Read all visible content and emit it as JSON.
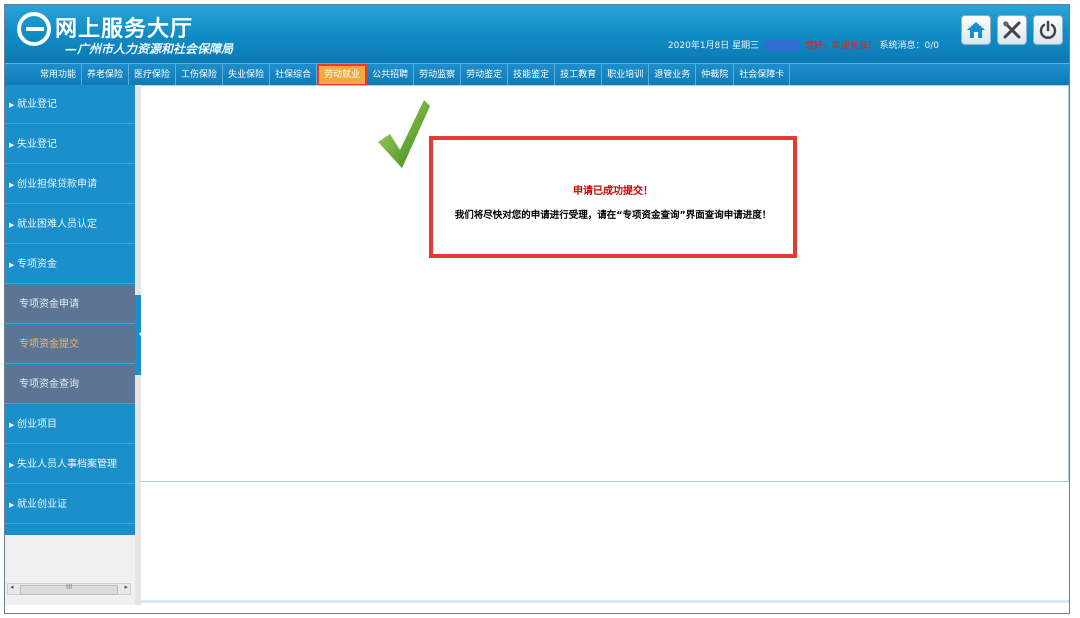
{
  "header": {
    "logo_title": "网上服务大厅",
    "logo_subtitle": "—广州市人力资源和社会保障局",
    "date": "2020年1月8日",
    "weekday": "星期三",
    "welcome": "您好，欢迎光临！",
    "messages_label": "系统消息：0/0",
    "buttons": [
      "home-icon",
      "tools-icon",
      "power-icon"
    ]
  },
  "nav": {
    "items": [
      "常用功能",
      "养老保险",
      "医疗保险",
      "工伤保险",
      "失业保险",
      "社保综合",
      "劳动就业",
      "公共招聘",
      "劳动监察",
      "劳动鉴定",
      "技能鉴定",
      "技工教育",
      "职业培训",
      "退管业务",
      "仲裁院",
      "社会保障卡"
    ],
    "active_index": 6
  },
  "sidebar": {
    "items": [
      {
        "label": "就业登记"
      },
      {
        "label": "失业登记"
      },
      {
        "label": "创业担保贷款申请"
      },
      {
        "label": "就业困难人员认定"
      },
      {
        "label": "专项资金"
      }
    ],
    "sub_items": [
      {
        "label": "专项资金申请"
      },
      {
        "label": "专项资金提交"
      },
      {
        "label": "专项资金查询"
      }
    ],
    "items_after": [
      {
        "label": "创业项目"
      },
      {
        "label": "失业人员人事档案管理"
      },
      {
        "label": "就业创业证"
      }
    ],
    "scroll_label": "III"
  },
  "message": {
    "title": "申请已成功提交！",
    "text": "我们将尽快对您的申请进行受理，请在“专项资金查询”界面查询申请进度！"
  },
  "colors": {
    "header_blue": "#128fc7",
    "nav_active": "#f3a93a",
    "highlight_red": "#e53935",
    "sidebar_sub": "#5c7594"
  }
}
